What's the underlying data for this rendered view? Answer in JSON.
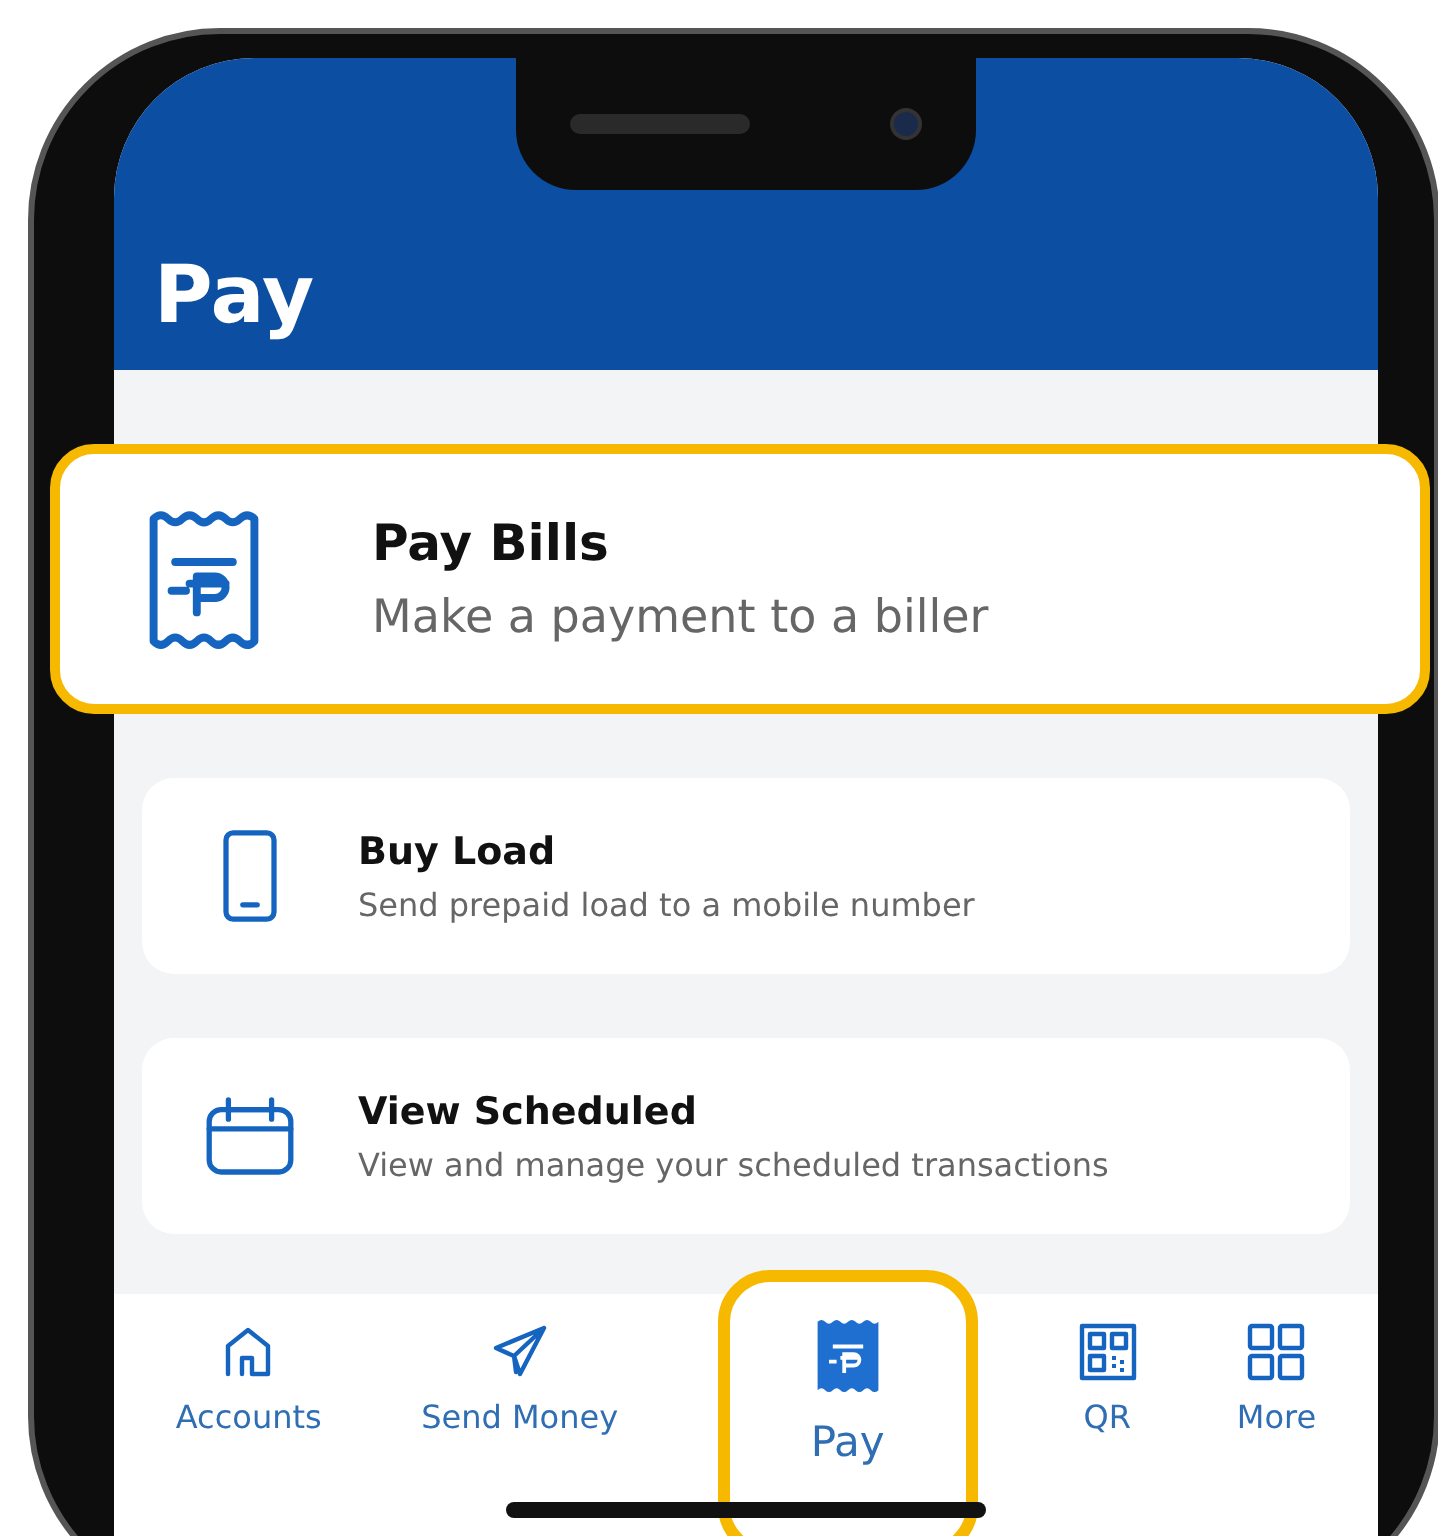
{
  "header": {
    "title": "Pay"
  },
  "menu_items": [
    {
      "kind": "bill",
      "title": "Pay Bills",
      "subtitle": "Make a payment to a biller",
      "highlighted": true
    },
    {
      "kind": "phone",
      "title": "Buy Load",
      "subtitle": "Send prepaid load to a mobile number",
      "highlighted": false
    },
    {
      "kind": "calendar",
      "title": "View Scheduled",
      "subtitle": "View and manage your scheduled transactions",
      "highlighted": false
    }
  ],
  "tab_bar": [
    {
      "kind": "home",
      "label": "Accounts",
      "selected": false,
      "highlighted": false
    },
    {
      "kind": "send",
      "label": "Send Money",
      "selected": false,
      "highlighted": false
    },
    {
      "kind": "bill",
      "label": "Pay",
      "selected": true,
      "highlighted": true
    },
    {
      "kind": "qr",
      "label": "QR",
      "selected": false,
      "highlighted": false
    },
    {
      "kind": "grid",
      "label": "More",
      "selected": false,
      "highlighted": false
    }
  ]
}
